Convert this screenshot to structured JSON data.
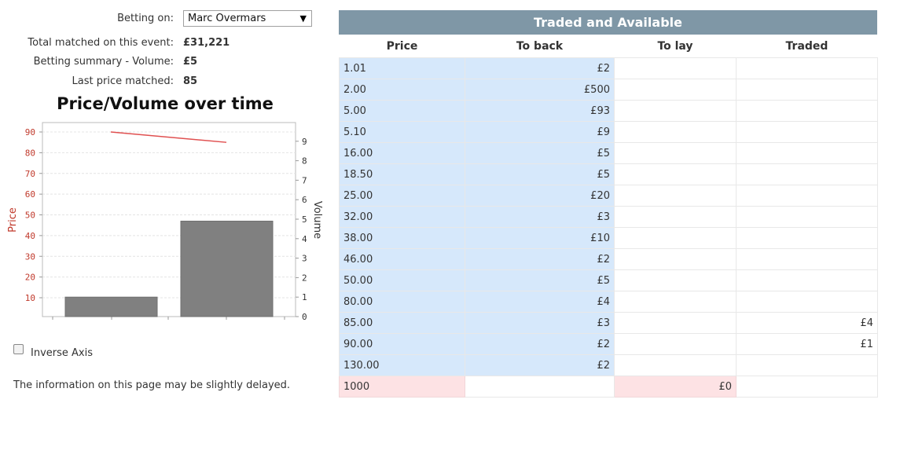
{
  "selection": {
    "betting_on_label": "Betting on:",
    "betting_on_value": "Marc Overmars"
  },
  "summary": {
    "total_matched_label": "Total matched on this event:",
    "total_matched_value": "£31,221",
    "betting_summary_label": "Betting summary - Volume:",
    "betting_summary_value": "£5",
    "last_price_label": "Last price matched:",
    "last_price_value": "85"
  },
  "chart_title": "Price/Volume over time",
  "chart_data": {
    "type": "bar",
    "title": "Price/Volume over time",
    "left_axis": {
      "label": "Price",
      "range": [
        0,
        90
      ],
      "ticks": [
        10,
        20,
        30,
        40,
        50,
        60,
        70,
        80,
        90
      ],
      "color": "#c0392b"
    },
    "right_axis": {
      "label": "Volume",
      "range": [
        0,
        9
      ],
      "ticks": [
        0,
        1,
        2,
        3,
        4,
        5,
        6,
        7,
        8,
        9
      ]
    },
    "volume_bars": [
      1,
      4.9
    ],
    "price_line": [
      90,
      85
    ],
    "bar_color": "#808080",
    "line_color": "#e05050",
    "grid": true
  },
  "inverse_axis_label": "Inverse Axis",
  "notice": "The information on this page may be slightly delayed.",
  "ladder": {
    "title": "Traded and Available",
    "columns": [
      "Price",
      "To back",
      "To lay",
      "Traded"
    ],
    "rows": [
      {
        "price": "1.01",
        "back": "£2",
        "lay": "",
        "traded": ""
      },
      {
        "price": "2.00",
        "back": "£500",
        "lay": "",
        "traded": ""
      },
      {
        "price": "5.00",
        "back": "£93",
        "lay": "",
        "traded": ""
      },
      {
        "price": "5.10",
        "back": "£9",
        "lay": "",
        "traded": ""
      },
      {
        "price": "16.00",
        "back": "£5",
        "lay": "",
        "traded": ""
      },
      {
        "price": "18.50",
        "back": "£5",
        "lay": "",
        "traded": ""
      },
      {
        "price": "25.00",
        "back": "£20",
        "lay": "",
        "traded": ""
      },
      {
        "price": "32.00",
        "back": "£3",
        "lay": "",
        "traded": ""
      },
      {
        "price": "38.00",
        "back": "£10",
        "lay": "",
        "traded": ""
      },
      {
        "price": "46.00",
        "back": "£2",
        "lay": "",
        "traded": ""
      },
      {
        "price": "50.00",
        "back": "£5",
        "lay": "",
        "traded": ""
      },
      {
        "price": "80.00",
        "back": "£4",
        "lay": "",
        "traded": ""
      },
      {
        "price": "85.00",
        "back": "£3",
        "lay": "",
        "traded": "£4"
      },
      {
        "price": "90.00",
        "back": "£2",
        "lay": "",
        "traded": "£1"
      },
      {
        "price": "130.00",
        "back": "£2",
        "lay": "",
        "traded": ""
      }
    ],
    "lay_rows": [
      {
        "price": "1000",
        "back": "",
        "lay": "£0",
        "traded": ""
      }
    ]
  },
  "colors": {
    "header_bg": "#7f97a6",
    "back_bg": "#d6e8fb",
    "lay_bg": "#fde2e4"
  }
}
